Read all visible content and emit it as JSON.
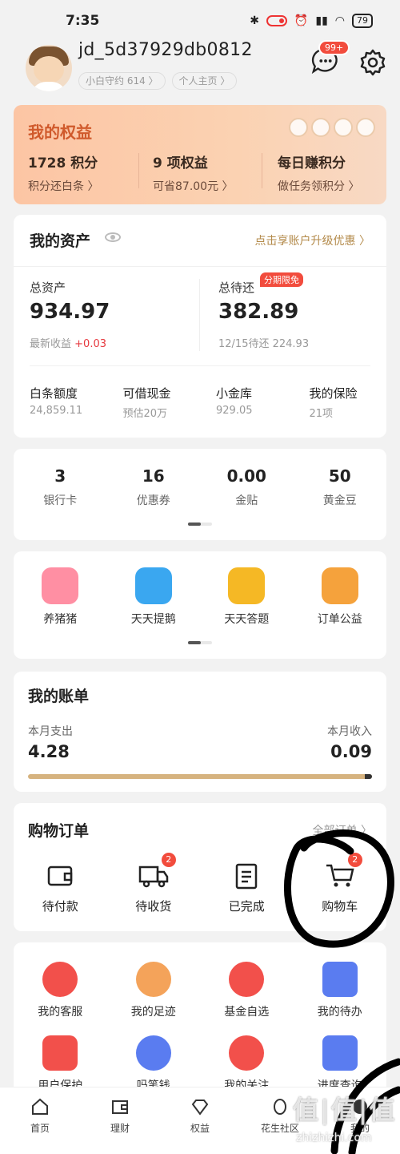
{
  "status": {
    "time": "7:35",
    "battery": "79"
  },
  "profile": {
    "username": "jd_5d37929db0812",
    "tags": [
      "小白守约 614 〉",
      "个人主页 〉"
    ],
    "message_badge": "99+"
  },
  "rights": {
    "title": "我的权益",
    "items": [
      {
        "value": "1728 积分",
        "sub": "积分还白条 〉"
      },
      {
        "value": "9 项权益",
        "sub": "可省87.00元 〉"
      },
      {
        "value": "每日赚积分",
        "sub": "做任务领积分 〉"
      }
    ]
  },
  "assets": {
    "title": "我的资产",
    "upgrade": "点击享账户升级优惠 〉",
    "total_label": "总资产",
    "total_value": "934.97",
    "income_label": "最新收益",
    "income_value": "+0.03",
    "due_label": "总待还",
    "due_badge": "分期限免",
    "due_value": "382.89",
    "due_sub": "12/15待还 224.93",
    "items": [
      {
        "title": "白条额度",
        "value": "24,859.11"
      },
      {
        "title": "可借现金",
        "value": "预估20万"
      },
      {
        "title": "小金库",
        "value": "929.05"
      },
      {
        "title": "我的保险",
        "value": "21项"
      }
    ]
  },
  "stats": [
    {
      "num": "3",
      "label": "银行卡"
    },
    {
      "num": "16",
      "label": "优惠券"
    },
    {
      "num": "0.00",
      "label": "金贴"
    },
    {
      "num": "50",
      "label": "黄金豆"
    }
  ],
  "games": [
    {
      "label": "养猪猪",
      "color": "#ff8fa3"
    },
    {
      "label": "天天提鹅",
      "color": "#3aa7f0"
    },
    {
      "label": "天天答题",
      "color": "#f5b825"
    },
    {
      "label": "订单公益",
      "color": "#f5a23c"
    }
  ],
  "bill": {
    "title": "我的账单",
    "spend_label": "本月支出",
    "spend_value": "4.28",
    "income_label": "本月收入",
    "income_value": "0.09",
    "income_fraction": 0.02
  },
  "orders": {
    "title": "购物订单",
    "all": "全部订单 〉",
    "items": [
      {
        "label": "待付款",
        "badge": ""
      },
      {
        "label": "待收货",
        "badge": "2"
      },
      {
        "label": "已完成",
        "badge": ""
      },
      {
        "label": "购物车",
        "badge": "2"
      }
    ]
  },
  "services": [
    {
      "label": "我的客服",
      "color": "#f2504b"
    },
    {
      "label": "我的足迹",
      "color": "#f4a35a"
    },
    {
      "label": "基金自选",
      "color": "#f2504b"
    },
    {
      "label": "我的待办",
      "color": "#5a7cf0"
    },
    {
      "label": "用户保护",
      "color": "#f2504b"
    },
    {
      "label": "吗笔钱",
      "color": "#5a7cf0"
    },
    {
      "label": "我的关注",
      "color": "#f2504b"
    },
    {
      "label": "进度查询",
      "color": "#5a7cf0"
    }
  ],
  "nav": [
    {
      "label": "首页",
      "icon": "home-icon"
    },
    {
      "label": "理财",
      "icon": "wallet-icon"
    },
    {
      "label": "权益",
      "icon": "diamond-icon"
    },
    {
      "label": "花生社区",
      "icon": "peanut-icon"
    },
    {
      "label": "我的",
      "icon": "profile-icon"
    }
  ],
  "watermark": {
    "main": "值|值|值",
    "sub": "zhizhizhi.com"
  }
}
